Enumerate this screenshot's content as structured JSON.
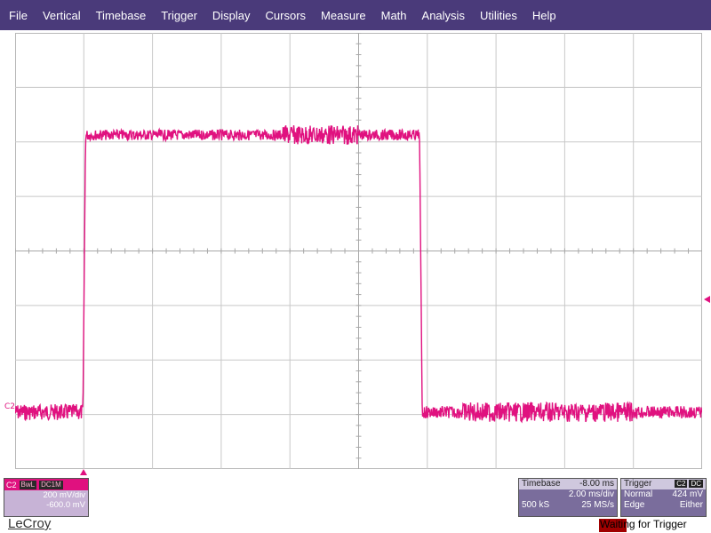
{
  "menu": [
    "File",
    "Vertical",
    "Timebase",
    "Trigger",
    "Display",
    "Cursors",
    "Measure",
    "Math",
    "Analysis",
    "Utilities",
    "Help"
  ],
  "channel": {
    "label": "C2",
    "tags": [
      "BwL",
      "DC1M"
    ],
    "vdiv": "200 mV/div",
    "offset": "-600.0 mV",
    "color": "#e0117f"
  },
  "timebase": {
    "title": "Timebase",
    "delay": "-8.00 ms",
    "tdiv": "2.00 ms/div",
    "samples": "500 kS",
    "rate": "25 MS/s"
  },
  "trigger": {
    "title": "Trigger",
    "source": "C2",
    "coupling": "DC",
    "mode": "Normal",
    "level": "424 mV",
    "type": "Edge",
    "slope": "Either"
  },
  "logo": "LeCroy",
  "status": "Waiting for Trigger",
  "waveform": {
    "description_levels": {
      "low": 0,
      "high": 1
    },
    "segments": [
      {
        "start": 0.0,
        "end": 0.1,
        "level": "low"
      },
      {
        "start": 0.1,
        "end": 0.59,
        "level": "high"
      },
      {
        "start": 0.59,
        "end": 1.0,
        "level": "low"
      }
    ]
  }
}
